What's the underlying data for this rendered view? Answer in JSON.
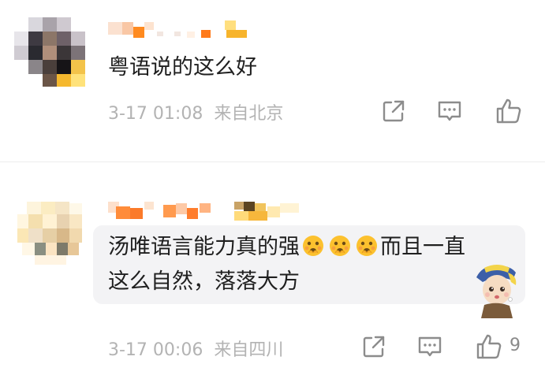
{
  "comments": [
    {
      "text": "粤语说的这么好",
      "time": "3-17 01:08",
      "location": "来自北京"
    },
    {
      "text_part1": "汤唯语言能力真的强",
      "text_part2": "而且一直",
      "text_line2": "这么自然，落落大方",
      "time": "3-17 00:06",
      "location": "来自四川",
      "like_count": "9"
    }
  ],
  "icons": {
    "share": "share-icon",
    "reply": "comment-icon",
    "like": "thumbs-up-icon",
    "emoji": "flushed-face-emoji",
    "sticker": "girl-with-pearl-earring-sticker"
  },
  "colors": {
    "text": "#1f1f1f",
    "meta": "#b3b3b3",
    "icon": "#8c8c8c",
    "bubble": "#f3f3f5"
  }
}
